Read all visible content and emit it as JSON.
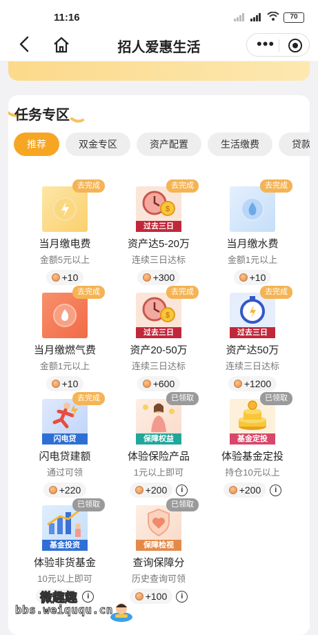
{
  "status_bar": {
    "time": "11:16",
    "battery": "70"
  },
  "nav": {
    "title": "招人爱惠生活"
  },
  "section": {
    "title": "任务专区"
  },
  "tabs": [
    "推荐",
    "双金专区",
    "资产配置",
    "生活缴费",
    "贷款"
  ],
  "status_labels": {
    "todo": "去完成",
    "done": "已领取"
  },
  "items": [
    {
      "title": "当月缴电费",
      "subtitle": "金额5元以上",
      "reward": "+10",
      "status": "去完成",
      "icon": "lightning-icon"
    },
    {
      "title": "资产达5-20万",
      "subtitle": "连续三日达标",
      "reward": "+300",
      "status": "去完成",
      "icon": "clock-coin-icon",
      "ribbon": "过去三日"
    },
    {
      "title": "当月缴水费",
      "subtitle": "金额1元以上",
      "reward": "+10",
      "status": "去完成",
      "icon": "water-drop-icon"
    },
    {
      "title": "当月缴燃气费",
      "subtitle": "金额1元以上",
      "reward": "+10",
      "status": "去完成",
      "icon": "gas-flame-icon"
    },
    {
      "title": "资产20-50万",
      "subtitle": "连续三日达标",
      "reward": "+600",
      "status": "去完成",
      "icon": "clock-coin-icon",
      "ribbon": "过去三日"
    },
    {
      "title": "资产达50万",
      "subtitle": "连续三日达标",
      "reward": "+1200",
      "status": "去完成",
      "icon": "stopwatch-icon",
      "ribbon": "过去三日"
    },
    {
      "title": "闪电贷建额",
      "subtitle": "通过可领",
      "reward": "+220",
      "status": "去完成",
      "icon": "running-man-icon",
      "ribbon": "闪电贷"
    },
    {
      "title": "体验保险产品",
      "subtitle": "1元以上即可",
      "reward": "+200",
      "status": "已领取",
      "icon": "insurance-lady-icon",
      "ribbon": "保障权益"
    },
    {
      "title": "体验基金定投",
      "subtitle": "持仓10元以上",
      "reward": "+200",
      "status": "已领取",
      "icon": "coin-stack-icon",
      "ribbon": "基金定投"
    },
    {
      "title": "体验非货基金",
      "subtitle": "10元以上即可",
      "reward": "+100",
      "status": "已领取",
      "icon": "chart-people-icon",
      "ribbon": "基金投资"
    },
    {
      "title": "查询保障分",
      "subtitle": "历史查询可领",
      "reward": "+100",
      "status": "已领取",
      "icon": "heart-shield-icon",
      "ribbon": "保障检视"
    }
  ],
  "watermark": {
    "cn": "微趣趣",
    "url": "bbs.weiququ.cn"
  },
  "colors": {
    "accent": "#f6a623",
    "todo_tag": "#f4b455",
    "done_tag": "#9a9a9a",
    "ribbon_red": "#c0283a"
  }
}
